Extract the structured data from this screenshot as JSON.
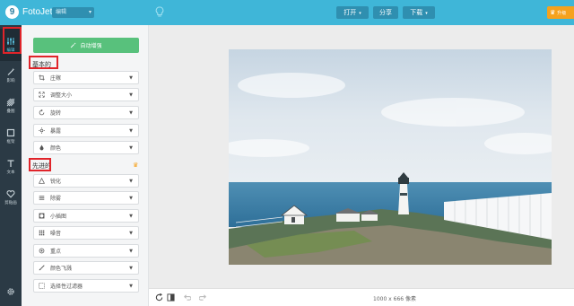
{
  "app": {
    "logo_text": "FotoJet",
    "logo_letter": "9"
  },
  "topbar": {
    "mode_select": "编辑",
    "open_label": "打开",
    "share_label": "分享",
    "download_label": "下载",
    "premium_label": "升级"
  },
  "rail": {
    "items": [
      {
        "label": "编辑",
        "icon": "sliders-icon",
        "active": true
      },
      {
        "label": "影响",
        "icon": "wand-icon"
      },
      {
        "label": "叠图",
        "icon": "texture-icon"
      },
      {
        "label": "框架",
        "icon": "frame-icon"
      },
      {
        "label": "文本",
        "icon": "text-icon"
      },
      {
        "label": "剪贴画",
        "icon": "heart-icon"
      }
    ]
  },
  "panel": {
    "auto_enhance_label": "自动增强",
    "basic_title": "基本的",
    "basic_items": [
      "庄稼",
      "调整大小",
      "旋转",
      "暴露",
      "颜色"
    ],
    "advanced_title": "先进的",
    "advanced_items": [
      "锐化",
      "除雾",
      "小插图",
      "噪音",
      "重点",
      "颜色飞溅",
      "选择性过滤器"
    ]
  },
  "canvas": {
    "dimensions": "1000 x 666 像素"
  },
  "colors": {
    "brand": "#3fb6d8",
    "rail": "#2b3a45",
    "accent_green": "#58c17c",
    "premium": "#f6a21d",
    "highlight": "#e0242a"
  }
}
